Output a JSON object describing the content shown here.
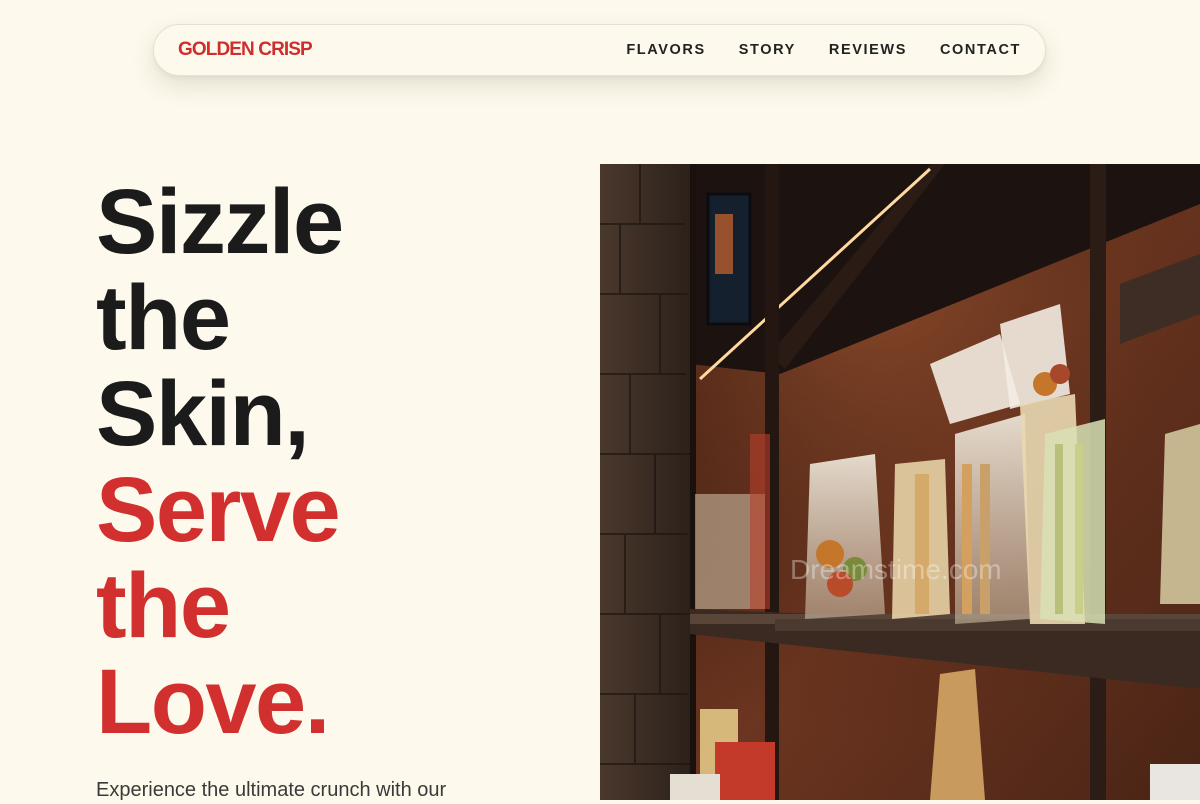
{
  "brand": {
    "name": "GOLDEN CRISP"
  },
  "nav": {
    "links": [
      {
        "label": "FLAVORS"
      },
      {
        "label": "STORY"
      },
      {
        "label": "REVIEWS"
      },
      {
        "label": "CONTACT"
      }
    ]
  },
  "hero": {
    "title_dark": [
      "Sizzle",
      "the",
      "Skin,"
    ],
    "title_red": [
      "Serve",
      "the",
      "Love."
    ],
    "subtitle": "Experience the ultimate crunch with our",
    "image_watermark": "Dreamstime.com"
  },
  "colors": {
    "accent": "#d1302f",
    "background": "#fdf9ec",
    "text": "#1b1b1b"
  }
}
